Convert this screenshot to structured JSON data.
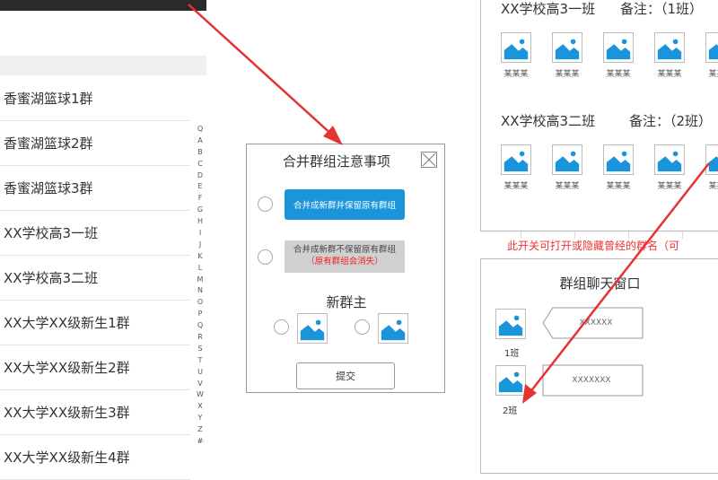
{
  "sidebar": {
    "groups": [
      "香蜜湖篮球1群",
      "香蜜湖篮球2群",
      "香蜜湖篮球3群",
      "XX学校高3一班",
      "XX学校高3二班",
      "XX大学XX级新生1群",
      "XX大学XX级新生2群",
      "XX大学XX级新生3群",
      "XX大学XX级新生4群"
    ],
    "index_letters": [
      "Q",
      "A",
      "B",
      "C",
      "D",
      "E",
      "F",
      "G",
      "H",
      "I",
      "J",
      "K",
      "L",
      "M",
      "N",
      "O",
      "P",
      "Q",
      "R",
      "S",
      "T",
      "U",
      "V",
      "W",
      "X",
      "Y",
      "Z",
      "#"
    ]
  },
  "dialog": {
    "title": "合并群组注意事项",
    "option_keep": "合并成新群并保留原有群组",
    "option_discard": "合并成新群不保留原有群组",
    "option_discard_warning": "（原有群组会消失）",
    "new_owner": "新群主",
    "submit": "提交"
  },
  "groups_panel": {
    "group1": {
      "title": "XX学校高3一班",
      "note": "备注：（1班）"
    },
    "group2": {
      "title": "XX学校高3二班",
      "note": "备注：（2班）"
    },
    "member_name": "某某某"
  },
  "toggle_note": "此开关可打开或隐藏曾经的群名（可",
  "chat": {
    "title": "群组聊天窗口",
    "messages": [
      {
        "label": "1班",
        "text": "XXXXXX"
      },
      {
        "label": "2班",
        "text": "XXXXXXX"
      }
    ]
  },
  "colors": {
    "accent": "#1a95db",
    "arrow": "#e53333",
    "warning": "#ee2222"
  }
}
